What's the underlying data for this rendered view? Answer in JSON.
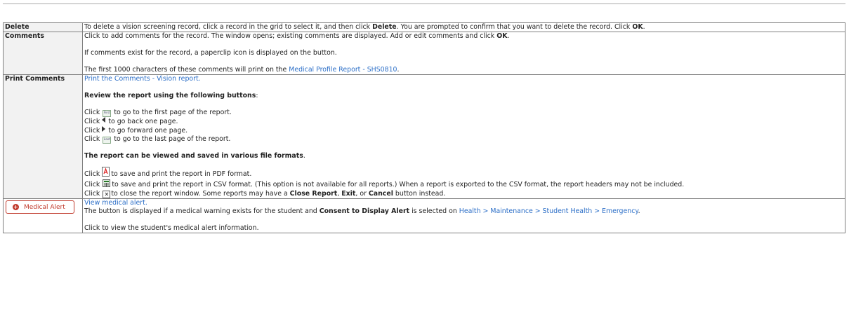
{
  "rows": {
    "delete": {
      "label": "Delete",
      "text_1": "To delete a vision screening record, click a record in the grid to select it, and then click ",
      "bold_1": "Delete",
      "text_2": ". You are prompted to confirm that you want to delete the record. Click ",
      "bold_2": "OK",
      "text_3": "."
    },
    "comments": {
      "label": "Comments",
      "p1_text": "Click to add comments for the record. The window opens; existing comments are displayed. Add or edit comments and click ",
      "p1_bold": "OK",
      "p1_end": ".",
      "p2": "If comments exist for the record, a paperclip icon is displayed on the button.",
      "p3_text": "The first 1000 characters of these comments will print on the ",
      "p3_link": "Medical Profile Report - SHS0810",
      "p3_end": "."
    },
    "print_comments": {
      "label": "Print Comments",
      "link": "Print the Comments - Vision report.",
      "review_heading": "Review the report using the following buttons",
      "review_colon": ":",
      "click": "Click",
      "first_icon_text": "First",
      "first_desc": "to go to the first page of the report.",
      "back_desc": "to go back one page.",
      "forward_desc": "to go forward one page.",
      "last_icon_text": "Last",
      "last_desc": "to go to the last page of the report.",
      "formats_heading": "The report can be viewed and saved in various file formats",
      "formats_period": ".",
      "pdf_desc": "to save and print the report in PDF format.",
      "csv_desc": "to save and print the report in CSV format. (This option is not available for all reports.) When a report is exported to the CSV format, the report headers may not be included.",
      "close_desc_1": "to close the report window. Some reports may have a ",
      "close_bold_1": "Close Report",
      "close_sep_1": ", ",
      "close_bold_2": "Exit",
      "close_sep_2": ", or ",
      "close_bold_3": "Cancel",
      "close_desc_2": " button instead."
    },
    "medical_alert": {
      "button_label": "Medical Alert",
      "link": "View medical alert.",
      "text_1": "The button is displayed if a medical warning exists for the student and ",
      "bold_1": "Consent to Display Alert",
      "text_2": " is selected on ",
      "path_link": "Health > Maintenance > Student Health > Emergency",
      "text_3": ".",
      "p2": "Click to view the student's medical alert information."
    }
  },
  "colors": {
    "link": "#2b6ec7",
    "alert_red": "#c0392b",
    "border": "#7f7f7f"
  }
}
